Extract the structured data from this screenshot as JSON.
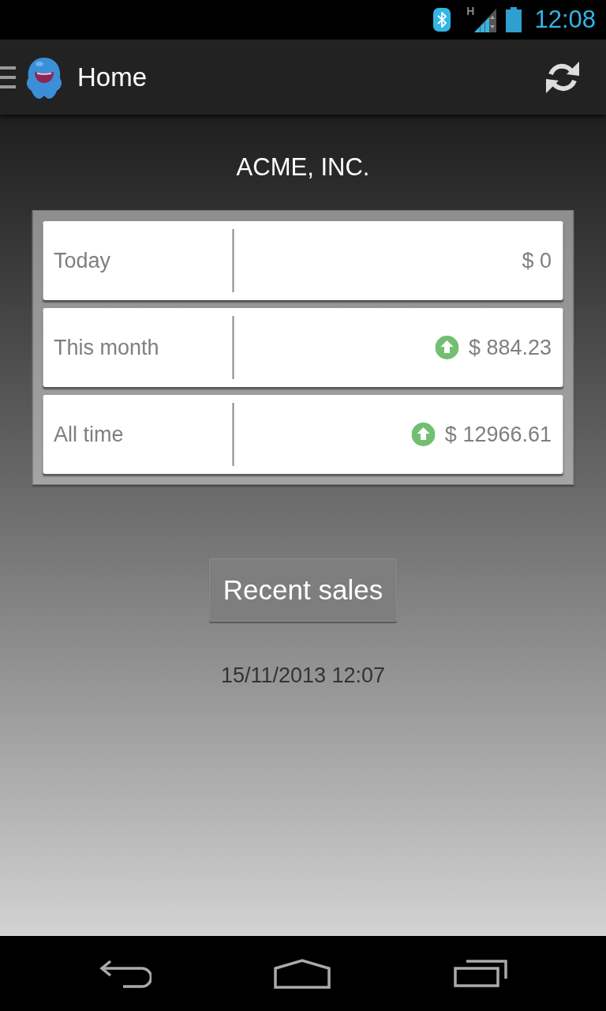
{
  "status_bar": {
    "network_type": "H",
    "time": "12:08"
  },
  "action_bar": {
    "title": "Home"
  },
  "company": "ACME, INC.",
  "summary": [
    {
      "label": "Today",
      "value": "$ 0",
      "trend_up": false
    },
    {
      "label": "This month",
      "value": "$ 884.23",
      "trend_up": true
    },
    {
      "label": "All time",
      "value": "$ 12966.61",
      "trend_up": true
    }
  ],
  "recent_sales_button": "Recent sales",
  "last_updated": "15/11/2013 12:07"
}
